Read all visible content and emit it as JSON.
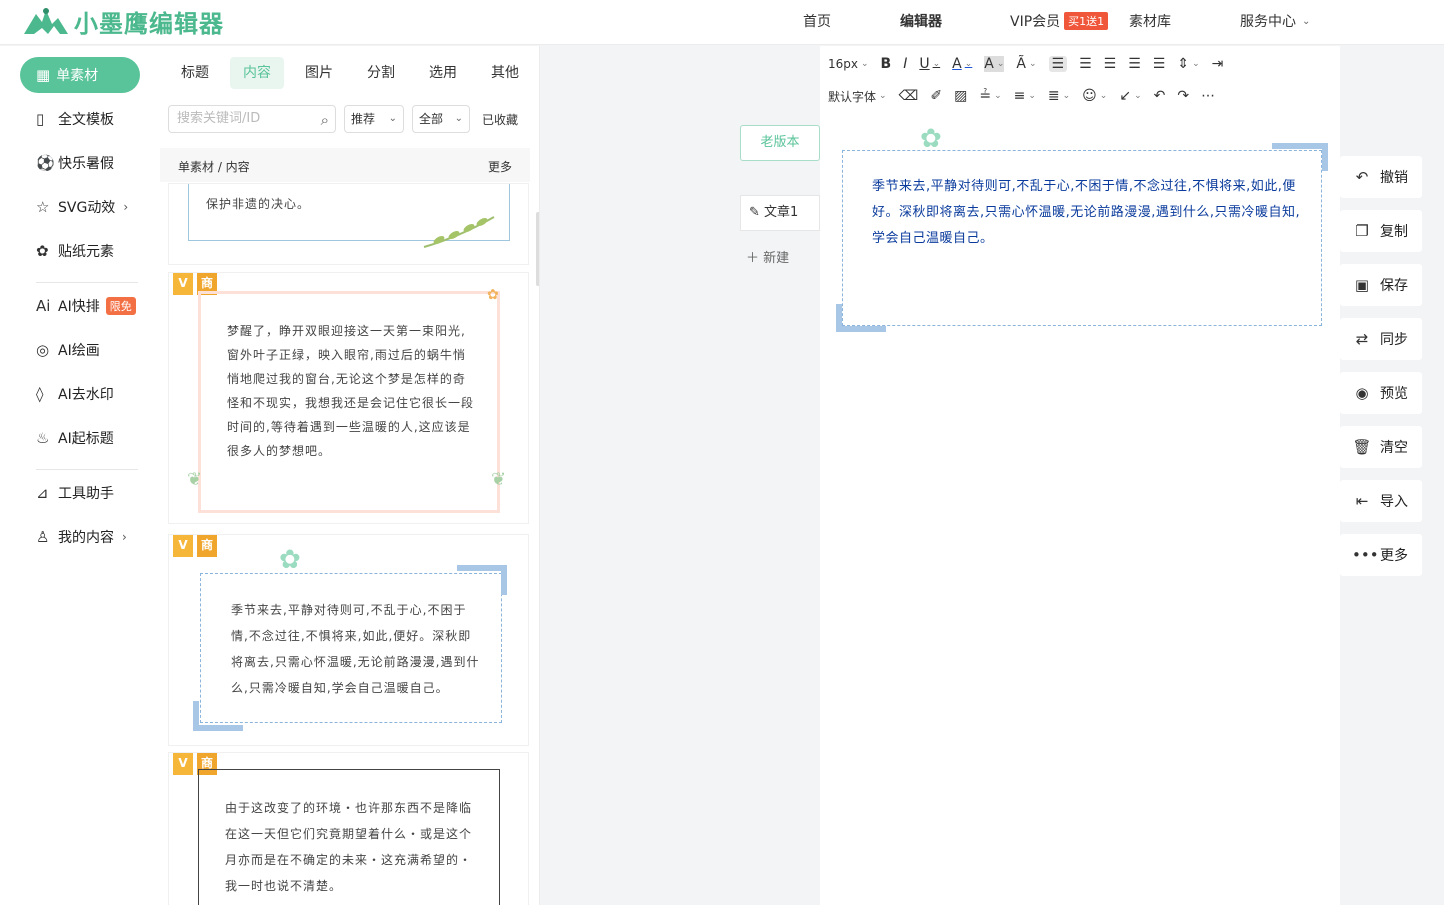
{
  "brand": {
    "name": "小墨鹰编辑器"
  },
  "nav": {
    "home": "首页",
    "editor": "编辑器",
    "vip": "VIP会员",
    "vip_badge": "买1送1",
    "library": "素材库",
    "service": "服务中心"
  },
  "sidebar": {
    "active": "单素材",
    "items": [
      "全文模板",
      "快乐暑假",
      "SVG动效",
      "贴纸元素",
      "AI快排",
      "AI绘画",
      "AI去水印",
      "AI起标题",
      "工具助手",
      "我的内容"
    ],
    "free_badge": "限免"
  },
  "panel": {
    "tabs": [
      "标题",
      "内容",
      "图片",
      "分割",
      "选用",
      "其他"
    ],
    "active_tab": "内容",
    "search_placeholder": "搜索关键词/ID",
    "filter_recommend": "推荐",
    "filter_all": "全部",
    "favorites": "已收藏",
    "breadcrumb": "单素材 / 内容",
    "more": "更多",
    "badge_v": "V",
    "badge_s": "商",
    "cards": [
      {
        "text": "保护非遗的决心。"
      },
      {
        "text": "梦醒了，睁开双眼迎接这一天第一束阳光,窗外叶子正绿，映入眼帘,雨过后的蜗牛悄悄地爬过我的窗台,无论这个梦是怎样的奇怪和不现实，我想我还是会记住它很长一段时间的,等待着遇到一些温暖的人,这应该是很多人的梦想吧。"
      },
      {
        "text": "季节来去,平静对待则可,不乱于心,不困于情,不念过往,不惧将来,如此,便好。深秋即将离去,只需心怀温暖,无论前路漫漫,遇到什么,只需冷暖自知,学会自己温暖自己。"
      },
      {
        "text": "由于这改变了的环境・也许那东西不是降临在这一天但它们究竟期望着什么・或是这个月亦而是在不确定的未来・这充满希望的・我一时也说不清楚。"
      }
    ]
  },
  "editor": {
    "old_version": "老版本",
    "doc_tab": "文章1",
    "new_doc": "新建",
    "font_size": "16px",
    "font_family": "默认字体",
    "content": "季节来去,平静对待则可,不乱于心,不困于情,不念过往,不惧将来,如此,便好。深秋即将离去,只需心怀温暖,无论前路漫漫,遇到什么,只需冷暖自知,学会自己温暖自己。"
  },
  "actions": [
    "撤销",
    "复制",
    "保存",
    "同步",
    "预览",
    "清空",
    "导入",
    "更多"
  ]
}
